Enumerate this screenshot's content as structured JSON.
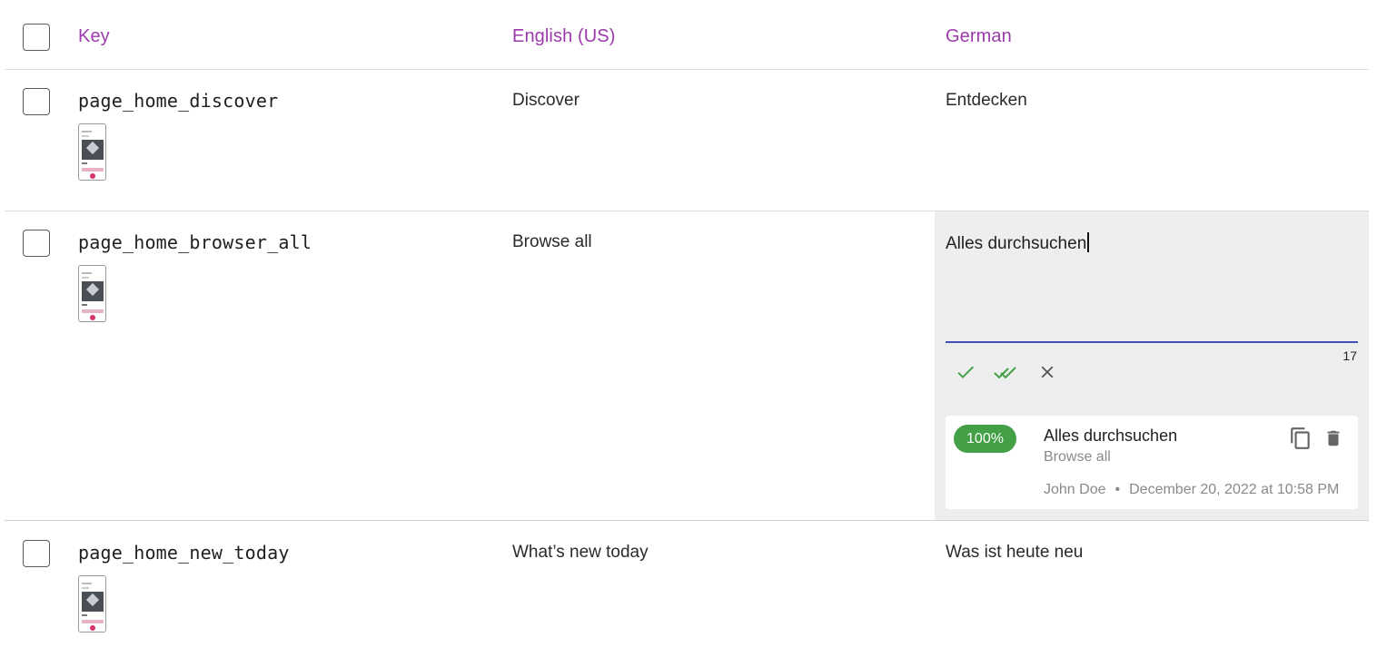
{
  "header": {
    "key_label": "Key",
    "col1_label": "English (US)",
    "col2_label": "German"
  },
  "rows": [
    {
      "key": "page_home_discover",
      "english": "Discover",
      "german": "Entdecken"
    },
    {
      "key": "page_home_browser_all",
      "english": "Browse all",
      "german": "Alles durchsuchen"
    },
    {
      "key": "page_home_new_today",
      "english": "What’s new today",
      "german": "Was ist heute neu"
    }
  ],
  "editor": {
    "value": "Alles durchsuchen",
    "char_count": "17",
    "actions": [
      "check-icon",
      "double-check-icon",
      "close-icon"
    ],
    "suggestion": {
      "match": "100%",
      "target": "Alles durchsuchen",
      "source": "Browse all",
      "author": "John Doe",
      "separator": "•",
      "date": "December 20, 2022 at 10:58 PM",
      "icons": [
        "copy-icon",
        "delete-icon"
      ]
    }
  },
  "colors": {
    "header_text": "#9c3aac",
    "accent_line": "#3f51b5",
    "success": "#43a047",
    "edit_background": "#eeeeee"
  }
}
